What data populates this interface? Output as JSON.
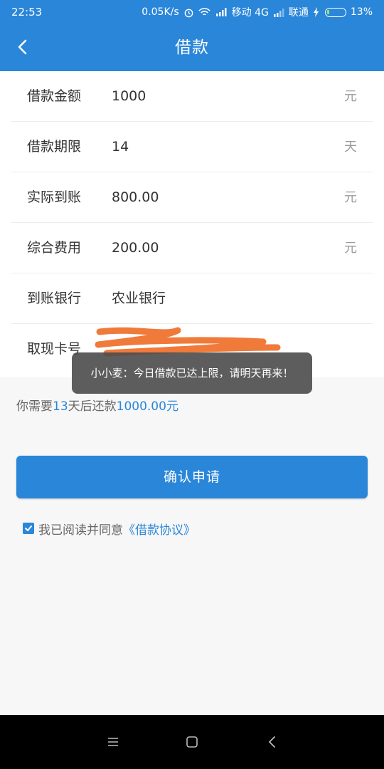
{
  "status_bar": {
    "time": "22:53",
    "speed": "0.05K/s",
    "carrier1": "移动 4G",
    "carrier2": "联通",
    "battery": "13%",
    "battery_level": 0.13
  },
  "header": {
    "title": "借款",
    "back_icon": "chevron-left-icon"
  },
  "form": {
    "rows": [
      {
        "label": "借款金额",
        "value": "1000",
        "unit": "元"
      },
      {
        "label": "借款期限",
        "value": "14",
        "unit": "天"
      },
      {
        "label": "实际到账",
        "value": "800.00",
        "unit": "元"
      },
      {
        "label": "综合费用",
        "value": "200.00",
        "unit": "元"
      },
      {
        "label": "到账银行",
        "value": "农业银行",
        "unit": ""
      },
      {
        "label": "取现卡号",
        "value": "",
        "unit": ""
      }
    ]
  },
  "toast": {
    "message": "小小麦：今日借款已达上限，请明天再来！"
  },
  "repay": {
    "prefix": "你需要",
    "days": "13",
    "middle": "天后还款",
    "amount": "1000.00元"
  },
  "confirm_label": "确认申请",
  "agreement": {
    "checked": true,
    "text": "我已阅读并同意",
    "link": "《借款协议》"
  },
  "colors": {
    "primary": "#2a86d9",
    "redaction": "#f07a3a"
  }
}
